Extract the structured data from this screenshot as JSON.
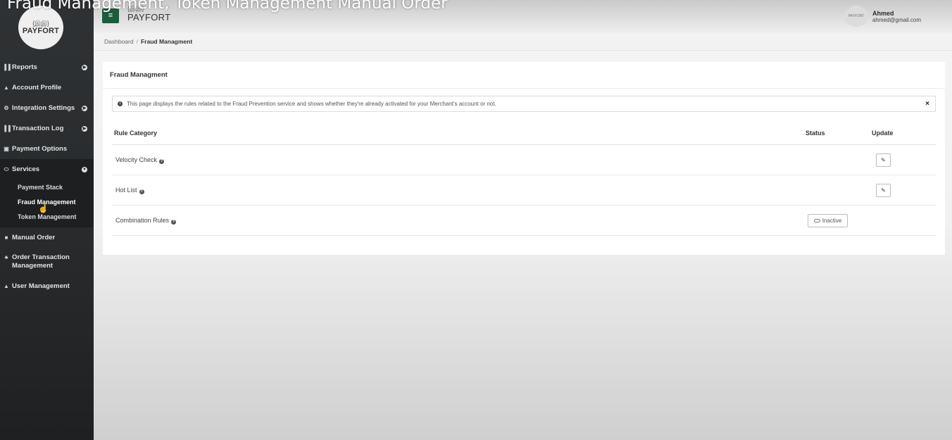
{
  "video_title": "Fraud Management, Token Management Manual Order",
  "sidebar": {
    "logo_glyph": "{இஇ}",
    "logo_word": "PAYFORT",
    "items": [
      {
        "label": "Reports",
        "icon": "bar-chart-icon",
        "glyph": "▐▐"
      },
      {
        "label": "Account Profile",
        "icon": "user-icon",
        "glyph": "▲"
      },
      {
        "label": "Integration Settings",
        "icon": "cogs-icon",
        "glyph": "⚙"
      },
      {
        "label": "Transaction Log",
        "icon": "bar-chart-icon",
        "glyph": "▐▐"
      },
      {
        "label": "Payment Options",
        "icon": "money-icon",
        "glyph": "▣"
      },
      {
        "label": "Services",
        "icon": "toggle-icon",
        "glyph": "⬭"
      },
      {
        "label": "Manual Order",
        "icon": "edit-icon",
        "glyph": "■"
      },
      {
        "label": "Order Transaction Management",
        "icon": "people-icon",
        "glyph": "♣"
      },
      {
        "label": "User Management",
        "icon": "lock-icon",
        "glyph": "▲"
      }
    ],
    "services_sub": [
      "Payment Stack",
      "Fraud Management",
      "Token Management"
    ]
  },
  "header": {
    "menu_glyph": "≡",
    "logo_word": "PAYFORT",
    "user_name": "Ahmed",
    "user_email": "ahmed@gmail.com",
    "avatar_text": "PAYFORT"
  },
  "breadcrumb": {
    "home": "Dashboard",
    "separator": "/",
    "current": "Fraud Managment"
  },
  "panel": {
    "title": "Fraud Managment",
    "alert_text": "This page displays the rules related to the Fraud Prevention service and shows whether they're already activated for your Merchant's account or not.",
    "close_glyph": "×"
  },
  "table": {
    "headers": {
      "category": "Rule Category",
      "status": "Status",
      "update": "Update"
    },
    "rows": [
      {
        "category": "Velocity Check",
        "status": "",
        "editable": true
      },
      {
        "category": "Hot List",
        "status": "",
        "editable": true
      },
      {
        "category": "Combination Rules",
        "status": "Inactive",
        "editable": false
      }
    ]
  },
  "colors": {
    "sidebar_bg": "#2b2d2f",
    "brand_green": "#1d5b3f",
    "brand_orange": "#c9762a"
  }
}
